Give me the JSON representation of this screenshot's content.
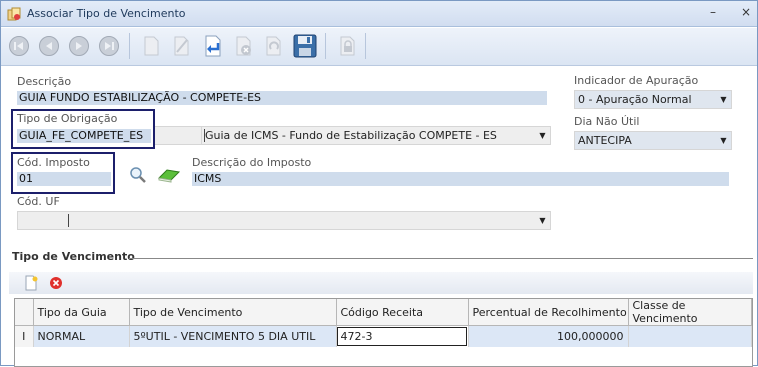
{
  "window": {
    "title": "Associar Tipo de Vencimento",
    "minimize": "–",
    "close": "×"
  },
  "form": {
    "descricao": {
      "label": "Descrição",
      "value": "GUIA FUNDO ESTABILIZAÇÃO - COMPETE-ES"
    },
    "tipo_obrigacao": {
      "label": "Tipo de Obrigação",
      "code": "GUIA_FE_COMPETE_ES",
      "description": "Guia de ICMS - Fundo de Estabilização COMPETE - ES"
    },
    "cod_imposto": {
      "label": "Cód. Imposto",
      "value": "01"
    },
    "descricao_imposto": {
      "label": "Descrição do Imposto",
      "value": "ICMS"
    },
    "cod_uf": {
      "label": "Cód. UF",
      "value": ""
    },
    "indicador_apuracao": {
      "label": "Indicador de Apuração",
      "value": "0 - Apuração Normal"
    },
    "dia_nao_util": {
      "label": "Dia Não Útil",
      "value": "ANTECIPA"
    }
  },
  "section": {
    "title": "Tipo de Vencimento"
  },
  "grid": {
    "columns": [
      "Tipo da Guia",
      "Tipo de Vencimento",
      "Código Receita",
      "Percentual de Recolhimento",
      "Classe de Vencimento"
    ],
    "row_indicator": "I",
    "rows": [
      {
        "tipo_guia": "NORMAL",
        "tipo_vencimento": "5ºUTIL - VENCIMENTO 5 DIA UTIL",
        "codigo_receita": "472-3",
        "percentual": "100,000000",
        "classe": ""
      }
    ]
  },
  "colors": {
    "accent": "#1c1f6b",
    "field_bg": "#cfdcec",
    "titlebar": "#dbe5f3"
  }
}
